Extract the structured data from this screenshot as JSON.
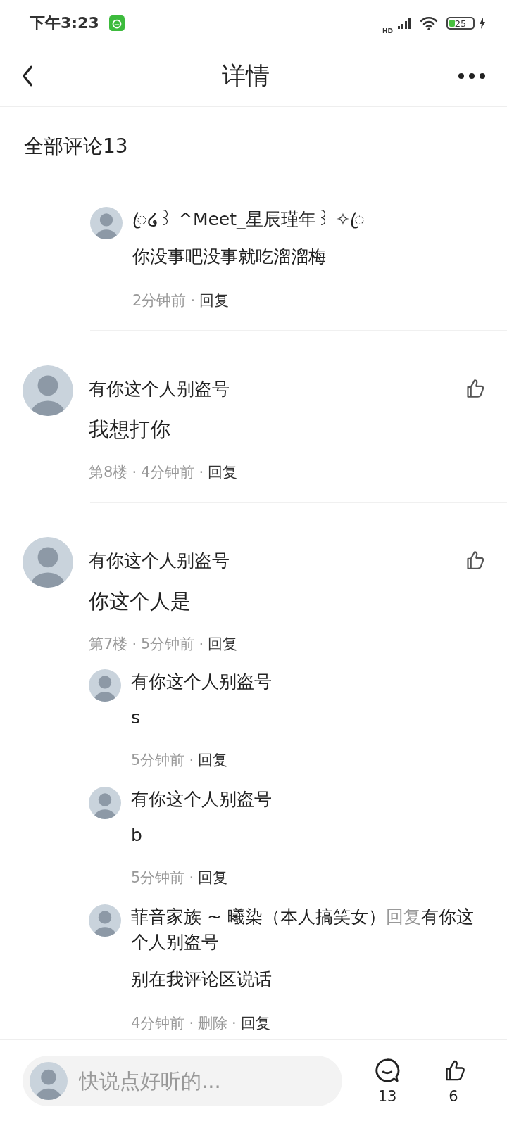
{
  "status_bar": {
    "time": "下午3:23",
    "network": "HD",
    "battery": "25"
  },
  "header": {
    "title": "详情"
  },
  "section_title": "全部评论13",
  "meta_separator": "·",
  "comments": [
    {
      "kind": "replies_only",
      "replies": [
        {
          "author": "ꦿ໒꒱ ^Meet_星辰瑾年꒱ ✧ꦿ",
          "text": "你没事吧没事就吃溜溜梅",
          "meta": [
            {
              "text": "2分钟前",
              "kind": "info"
            },
            {
              "text": "回复",
              "kind": "action"
            }
          ]
        }
      ]
    },
    {
      "kind": "full",
      "author": "有你这个人别盗号",
      "text": "我想打你",
      "meta": [
        {
          "text": "第8楼",
          "kind": "info"
        },
        {
          "text": "4分钟前",
          "kind": "info"
        },
        {
          "text": "回复",
          "kind": "action"
        }
      ]
    },
    {
      "kind": "full",
      "author": "有你这个人别盗号",
      "text": "你这个人是",
      "meta": [
        {
          "text": "第7楼",
          "kind": "info"
        },
        {
          "text": "5分钟前",
          "kind": "info"
        },
        {
          "text": "回复",
          "kind": "action"
        }
      ],
      "replies": [
        {
          "author": "有你这个人别盗号",
          "text": "s",
          "meta": [
            {
              "text": "5分钟前",
              "kind": "info"
            },
            {
              "text": "回复",
              "kind": "action"
            }
          ]
        },
        {
          "author": "有你这个人别盗号",
          "text": "b",
          "meta": [
            {
              "text": "5分钟前",
              "kind": "info"
            },
            {
              "text": "回复",
              "kind": "action"
            }
          ]
        },
        {
          "author": "菲音家族 ~ 曦染（本人搞笑女）",
          "reply_word": "回复",
          "reply_target": "有你这个人别盗号",
          "text": "别在我评论区说话",
          "meta": [
            {
              "text": "4分钟前",
              "kind": "info"
            },
            {
              "text": "删除",
              "kind": "info"
            },
            {
              "text": "回复",
              "kind": "action"
            }
          ]
        }
      ]
    }
  ],
  "bottom_bar": {
    "placeholder": "快说点好听的...",
    "comment_count": "13",
    "like_count": "6"
  }
}
